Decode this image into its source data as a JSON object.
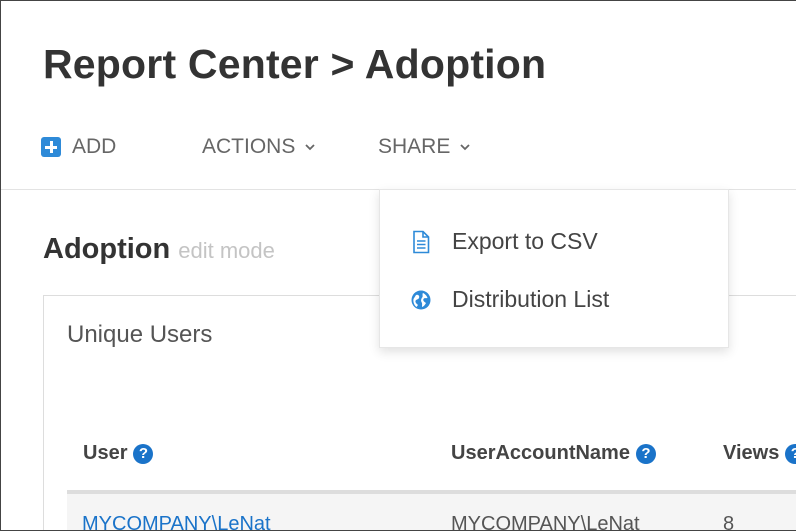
{
  "header": {
    "title": "Report Center > Adoption"
  },
  "toolbar": {
    "add_label": "ADD",
    "actions_label": "ACTIONS",
    "share_label": "SHARE"
  },
  "subheader": {
    "title": "Adoption",
    "mode": "edit mode"
  },
  "share_menu": {
    "items": [
      {
        "label": "Export to CSV",
        "icon": "document-icon"
      },
      {
        "label": "Distribution List",
        "icon": "globe-icon"
      }
    ]
  },
  "card": {
    "title": "Unique Users",
    "columns": [
      {
        "label": "User",
        "help": true
      },
      {
        "label": "UserAccountName",
        "help": true
      },
      {
        "label": "Views",
        "help": true
      }
    ],
    "rows": [
      {
        "user": "MYCOMPANY\\LeNat",
        "account": "MYCOMPANY\\LeNat",
        "views": "8"
      }
    ]
  },
  "colors": {
    "accent": "#2e8ad8",
    "link": "#1a73c9",
    "muted": "#c4c4c4"
  }
}
